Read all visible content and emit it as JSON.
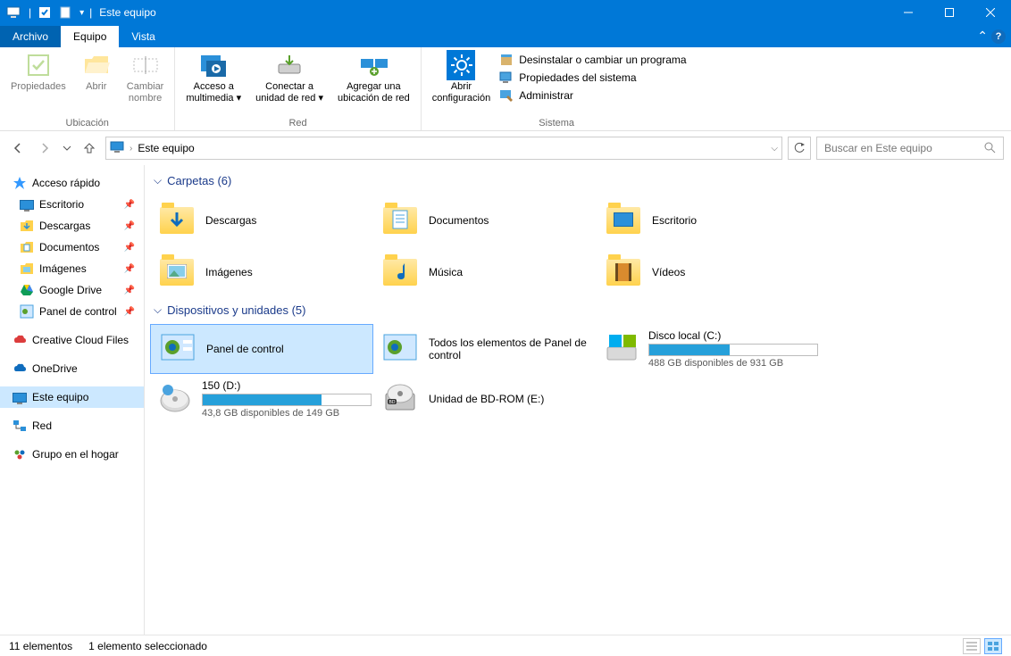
{
  "window": {
    "title": "Este equipo"
  },
  "tabs": {
    "file": "Archivo",
    "equipo": "Equipo",
    "vista": "Vista"
  },
  "ribbon": {
    "ubicacion": {
      "label": "Ubicación",
      "propiedades": "Propiedades",
      "abrir": "Abrir",
      "cambiar_nombre": "Cambiar\nnombre"
    },
    "red": {
      "label": "Red",
      "acceso": "Acceso a\nmultimedia",
      "conectar": "Conectar a\nunidad de red",
      "agregar": "Agregar una\nubicación de red"
    },
    "sistema": {
      "label": "Sistema",
      "abrir_config": "Abrir\nconfiguración",
      "desinstalar": "Desinstalar o cambiar un programa",
      "propiedades": "Propiedades del sistema",
      "administrar": "Administrar"
    }
  },
  "address": {
    "text": "Este equipo"
  },
  "search": {
    "placeholder": "Buscar en Este equipo"
  },
  "sidebar": {
    "quick": "Acceso rápido",
    "items": [
      {
        "label": "Escritorio",
        "pinned": true
      },
      {
        "label": "Descargas",
        "pinned": true
      },
      {
        "label": "Documentos",
        "pinned": true
      },
      {
        "label": "Imágenes",
        "pinned": true
      },
      {
        "label": "Google Drive",
        "pinned": true
      },
      {
        "label": "Panel de control",
        "pinned": true
      }
    ],
    "creative": "Creative Cloud Files",
    "onedrive": "OneDrive",
    "pc": "Este equipo",
    "network": "Red",
    "homegroup": "Grupo en el hogar"
  },
  "sections": {
    "folders": {
      "title": "Carpetas (6)",
      "items": [
        {
          "label": "Descargas"
        },
        {
          "label": "Documentos"
        },
        {
          "label": "Escritorio"
        },
        {
          "label": "Imágenes"
        },
        {
          "label": "Música"
        },
        {
          "label": "Vídeos"
        }
      ]
    },
    "drives": {
      "title": "Dispositivos y unidades (5)",
      "items": [
        {
          "label": "Panel de control",
          "selected": true,
          "type": "cp"
        },
        {
          "label": "Todos los elementos de Panel de control",
          "type": "cp"
        },
        {
          "label": "Disco local (C:)",
          "sub": "488 GB disponibles de 931 GB",
          "fill": 48,
          "type": "disk"
        },
        {
          "label": "150 (D:)",
          "sub": "43,8 GB disponibles de 149 GB",
          "fill": 71,
          "type": "disk"
        },
        {
          "label": "Unidad de BD-ROM (E:)",
          "type": "bd"
        }
      ]
    }
  },
  "status": {
    "count": "11 elementos",
    "selected": "1 elemento seleccionado"
  }
}
